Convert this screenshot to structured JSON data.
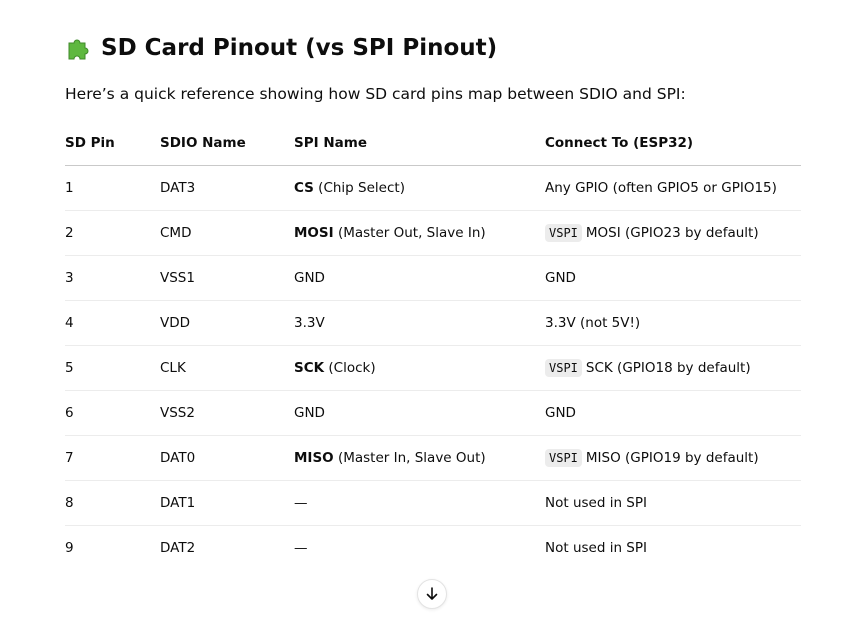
{
  "heading": {
    "icon": "puzzle-piece-icon",
    "icon_color": "#5fb840",
    "text": "SD Card Pinout (vs SPI Pinout)"
  },
  "intro": "Here’s a quick reference showing how SD card pins map between SDIO and SPI:",
  "table": {
    "columns": [
      "SD Pin",
      "SDIO Name",
      "SPI Name",
      "Connect To (ESP32)"
    ],
    "rows": [
      {
        "pin": "1",
        "sdio": "DAT3",
        "spi_name": "CS",
        "spi_desc": " (Chip Select)",
        "connect_code": "",
        "connect_text": "Any GPIO (often GPIO5 or GPIO15)"
      },
      {
        "pin": "2",
        "sdio": "CMD",
        "spi_name": "MOSI",
        "spi_desc": " (Master Out, Slave In)",
        "connect_code": "VSPI",
        "connect_text": "MOSI (GPIO23 by default)"
      },
      {
        "pin": "3",
        "sdio": "VSS1",
        "spi_name": "",
        "spi_desc": "GND",
        "connect_code": "",
        "connect_text": "GND"
      },
      {
        "pin": "4",
        "sdio": "VDD",
        "spi_name": "",
        "spi_desc": "3.3V",
        "connect_code": "",
        "connect_text": "3.3V (not 5V!)"
      },
      {
        "pin": "5",
        "sdio": "CLK",
        "spi_name": "SCK",
        "spi_desc": " (Clock)",
        "connect_code": "VSPI",
        "connect_text": "SCK (GPIO18 by default)"
      },
      {
        "pin": "6",
        "sdio": "VSS2",
        "spi_name": "",
        "spi_desc": "GND",
        "connect_code": "",
        "connect_text": "GND"
      },
      {
        "pin": "7",
        "sdio": "DAT0",
        "spi_name": "MISO",
        "spi_desc": " (Master In, Slave Out)",
        "connect_code": "VSPI",
        "connect_text": "MISO (GPIO19 by default)"
      },
      {
        "pin": "8",
        "sdio": "DAT1",
        "spi_name": "",
        "spi_desc": "—",
        "connect_code": "",
        "connect_text": "Not used in SPI"
      },
      {
        "pin": "9",
        "sdio": "DAT2",
        "spi_name": "",
        "spi_desc": "—",
        "connect_code": "",
        "connect_text": "Not used in SPI"
      }
    ]
  },
  "scroll_button": {
    "icon": "arrow-down-icon"
  }
}
